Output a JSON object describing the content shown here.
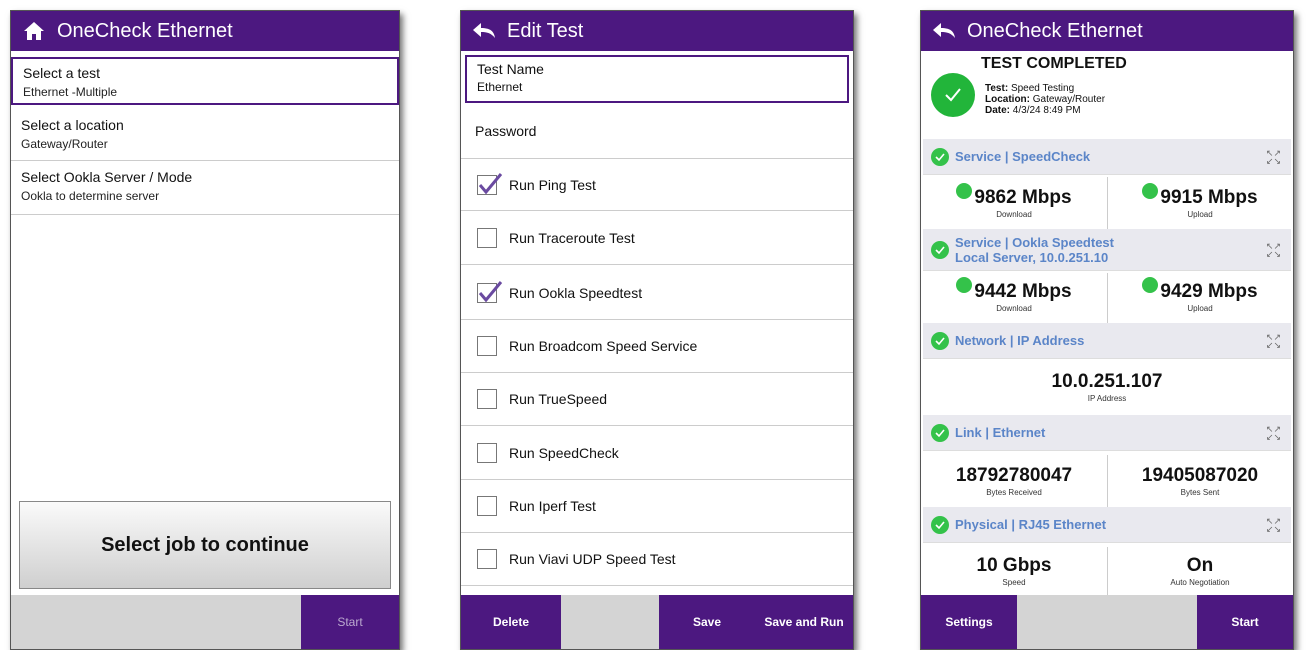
{
  "screen1": {
    "title": "OneCheck Ethernet",
    "items": [
      {
        "label": "Select a test",
        "value": "Ethernet -Multiple"
      },
      {
        "label": "Select a location",
        "value": "Gateway/Router"
      },
      {
        "label": "Select Ookla Server / Mode",
        "value": "Ookla to determine server"
      }
    ],
    "big_button": "Select job to continue",
    "start": "Start"
  },
  "screen2": {
    "title": "Edit Test",
    "test_name_label": "Test Name",
    "test_name_value": "Ethernet",
    "password_label": "Password",
    "options": [
      {
        "label": "Run Ping Test",
        "checked": true
      },
      {
        "label": "Run Traceroute Test",
        "checked": false
      },
      {
        "label": "Run Ookla Speedtest",
        "checked": true
      },
      {
        "label": "Run Broadcom Speed Service",
        "checked": false
      },
      {
        "label": "Run TrueSpeed",
        "checked": false
      },
      {
        "label": "Run SpeedCheck",
        "checked": false
      },
      {
        "label": "Run Iperf Test",
        "checked": false
      },
      {
        "label": "Run Viavi UDP Speed Test",
        "checked": false
      }
    ],
    "delete": "Delete",
    "save": "Save",
    "save_and_run": "Save and Run"
  },
  "screen3": {
    "title": "OneCheck Ethernet",
    "status": "TEST COMPLETED",
    "test_label": "Test:",
    "test_value": "Speed Testing",
    "location_label": "Location:",
    "location_value": "Gateway/Router",
    "date_label": "Date:",
    "date_value": "4/3/24 8:49 PM",
    "speedcheck": {
      "title": "Service | SpeedCheck",
      "download": "9862 Mbps",
      "download_label": "Download",
      "upload": "9915 Mbps",
      "upload_label": "Upload"
    },
    "ookla": {
      "title": "Service | Ookla Speedtest",
      "subtitle": "Local Server, 10.0.251.10",
      "download": "9442 Mbps",
      "download_label": "Download",
      "upload": "9429 Mbps",
      "upload_label": "Upload"
    },
    "network": {
      "title": "Network | IP Address",
      "ip": "10.0.251.107",
      "ip_label": "IP Address"
    },
    "link": {
      "title": "Link | Ethernet",
      "received": "18792780047",
      "received_label": "Bytes Received",
      "sent": "19405087020",
      "sent_label": "Bytes Sent"
    },
    "physical": {
      "title": "Physical | RJ45 Ethernet",
      "speed": "10 Gbps",
      "speed_label": "Speed",
      "autoneg": "On",
      "autoneg_label": "Auto Negotiation"
    },
    "settings": "Settings",
    "start": "Start"
  },
  "colors": {
    "header": "#4c1880",
    "accent_check": "#34c24a",
    "section_title": "#5b85c8"
  }
}
